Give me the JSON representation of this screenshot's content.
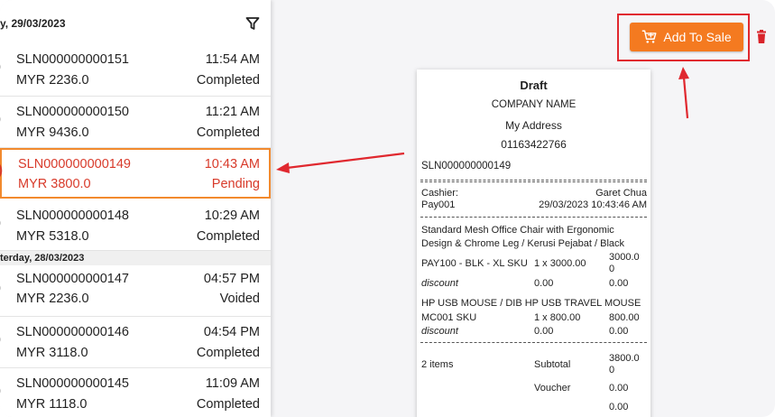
{
  "headers": [
    {
      "text": "y, 29/03/2023"
    },
    {
      "text": "terday, 28/03/2023"
    }
  ],
  "transactions": [
    {
      "id": "SLN000000000151",
      "amount": "MYR 2236.0",
      "time": "11:54 AM",
      "status": "Completed"
    },
    {
      "id": "SLN000000000150",
      "amount": "MYR 9436.0",
      "time": "11:21 AM",
      "status": "Completed"
    },
    {
      "id": "SLN000000000149",
      "amount": "MYR 3800.0",
      "time": "10:43 AM",
      "status": "Pending"
    },
    {
      "id": "SLN000000000148",
      "amount": "MYR 5318.0",
      "time": "10:29 AM",
      "status": "Completed"
    },
    {
      "id": "SLN000000000147",
      "amount": "MYR 2236.0",
      "time": "04:57 PM",
      "status": "Voided"
    },
    {
      "id": "SLN000000000146",
      "amount": "MYR 3118.0",
      "time": "04:54 PM",
      "status": "Completed"
    },
    {
      "id": "SLN000000000145",
      "amount": "MYR 1118.0",
      "time": "11:09 AM",
      "status": "Completed"
    }
  ],
  "add_to_sale": {
    "label": "Add To Sale"
  },
  "receipt": {
    "title": "Draft",
    "company": "COMPANY NAME",
    "address": "My Address",
    "phone": "01163422766",
    "sln": "SLN000000000149",
    "cashier_label": "Cashier:",
    "cashier_name": "Garet Chua",
    "pay_id": "Pay001",
    "datetime": "29/03/2023 10:43:46 AM",
    "items": [
      {
        "name_line1": "Standard Mesh Office Chair with Ergonomic",
        "name_line2": "Design & Chrome Leg / Kerusi Pejabat / Black",
        "sku": "PAY100 - BLK - XL SKU",
        "qty_price": "1 x 3000.00",
        "total": "3000.0",
        "total_wrap": "0",
        "discount_label": "discount",
        "discount_value": "0.00",
        "discount_total": "0.00"
      },
      {
        "name_line1": "HP USB MOUSE / DIB HP USB TRAVEL MOUSE",
        "sku": "MC001 SKU",
        "qty_price": "1 x 800.00",
        "total": "800.00",
        "discount_label": "discount",
        "discount_value": "0.00",
        "discount_total": "0.00"
      }
    ],
    "item_count": "2 items",
    "subtotal_label": "Subtotal",
    "subtotal_value": "3800.0",
    "subtotal_wrap": "0",
    "voucher_label": "Voucher",
    "voucher_value": "0.00",
    "last_value": "0.00"
  },
  "colors": {
    "accent": "#f47a20",
    "highlight": "#e0282f",
    "pending": "#d83a2a"
  }
}
